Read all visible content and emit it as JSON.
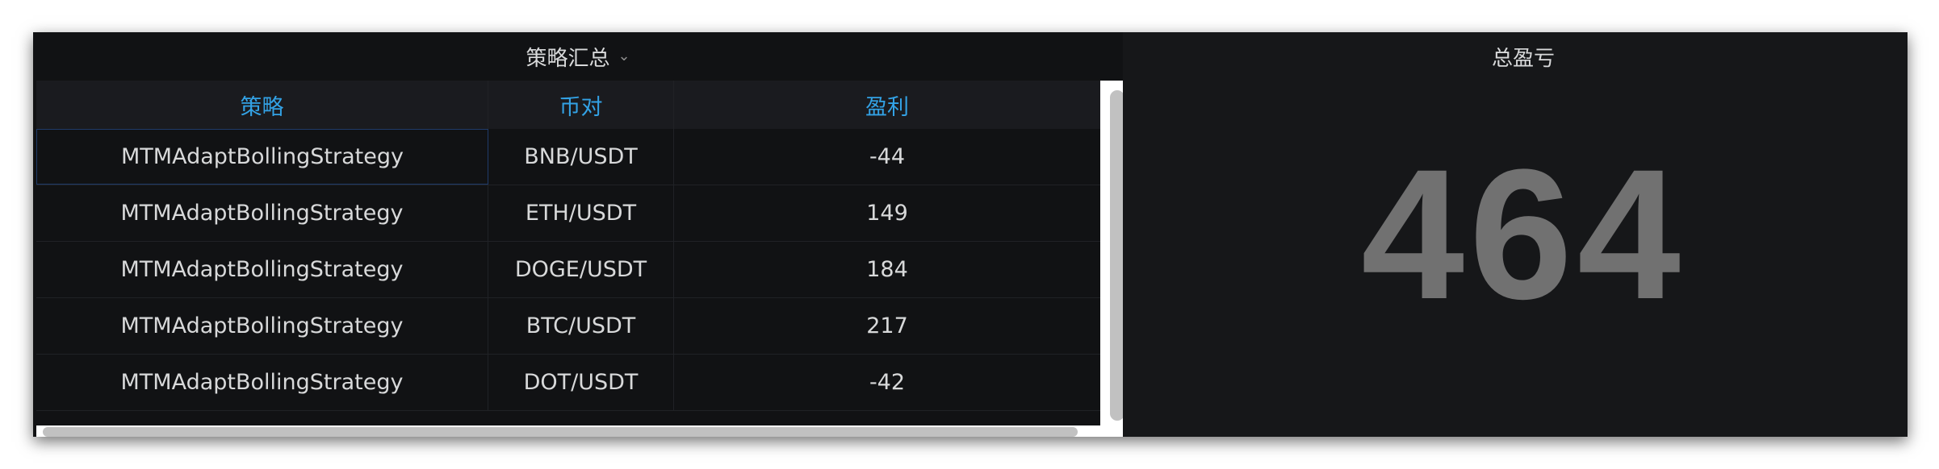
{
  "strategy_panel": {
    "title": "策略汇总",
    "columns": [
      "策略",
      "币对",
      "盈利"
    ],
    "rows": [
      {
        "strategy": "MTMAdaptBollingStrategy",
        "pair": "BNB/USDT",
        "profit": "-44"
      },
      {
        "strategy": "MTMAdaptBollingStrategy",
        "pair": "ETH/USDT",
        "profit": "149"
      },
      {
        "strategy": "MTMAdaptBollingStrategy",
        "pair": "DOGE/USDT",
        "profit": "184"
      },
      {
        "strategy": "MTMAdaptBollingStrategy",
        "pair": "BTC/USDT",
        "profit": "217"
      },
      {
        "strategy": "MTMAdaptBollingStrategy",
        "pair": "DOT/USDT",
        "profit": "-42"
      }
    ]
  },
  "total_panel": {
    "title": "总盈亏",
    "value": "464"
  },
  "colors": {
    "header_text": "#33a2e5",
    "cell_text": "#d8d9da",
    "stat_text": "#717171",
    "panel_bg": "#111214"
  }
}
